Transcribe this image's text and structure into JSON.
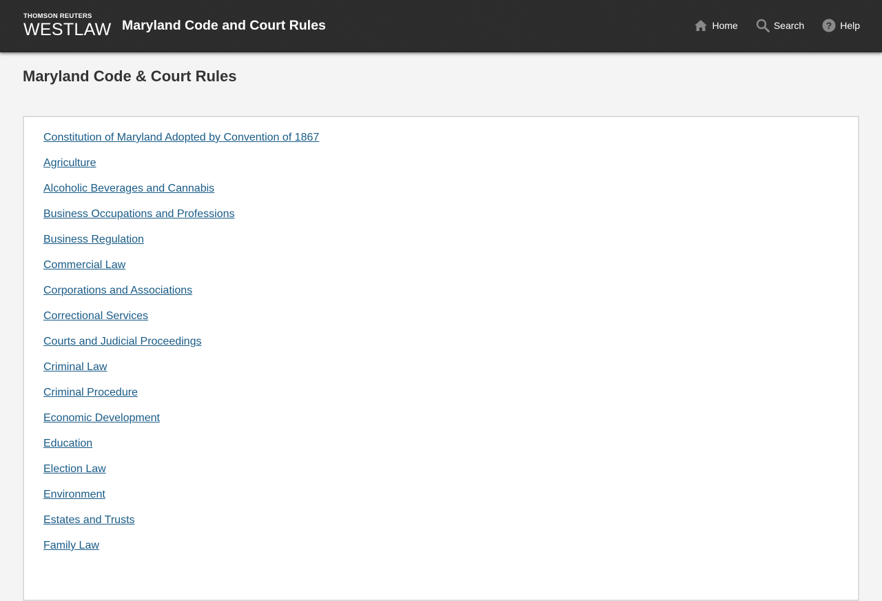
{
  "header": {
    "logo_sub": "THOMSON REUTERS",
    "logo_main": "WESTLAW",
    "app_title": "Maryland Code and Court Rules",
    "nav": {
      "home": {
        "label": "Home",
        "icon": "home-icon"
      },
      "search": {
        "label": "Search",
        "icon": "search-icon"
      },
      "help": {
        "label": "Help",
        "icon": "help-icon"
      }
    }
  },
  "page": {
    "title": "Maryland Code & Court Rules"
  },
  "code_list": [
    "Constitution of Maryland Adopted by Convention of 1867",
    "Agriculture",
    "Alcoholic Beverages and Cannabis",
    "Business Occupations and Professions",
    "Business Regulation",
    "Commercial Law",
    "Corporations and Associations",
    "Correctional Services",
    "Courts and Judicial Proceedings",
    "Criminal Law",
    "Criminal Procedure",
    "Economic Development",
    "Education",
    "Election Law",
    "Environment",
    "Estates and Trusts",
    "Family Law"
  ],
  "colors": {
    "header_bg": "#2c2c2c",
    "link": "#195b87",
    "page_bg": "#f4f4f4"
  }
}
